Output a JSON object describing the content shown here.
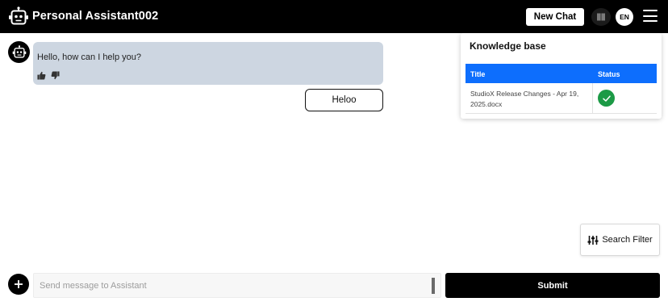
{
  "header": {
    "app_title": "Personal Assistant002",
    "new_chat_label": "New Chat",
    "language": "EN",
    "icons": [
      "robot-logo-icon",
      "book-icon",
      "hamburger-menu-icon"
    ]
  },
  "chat": {
    "messages": [
      {
        "role": "assistant",
        "text": "Hello, how can I help you?"
      },
      {
        "role": "user",
        "text": "Heloo"
      }
    ]
  },
  "knowledge_base": {
    "title": "Knowledge base",
    "columns": [
      "Title",
      "Status"
    ],
    "rows": [
      {
        "title": "StudioX Release Changes - Apr 19, 2025.docx",
        "status_icon": "check-icon"
      }
    ]
  },
  "search_filter": {
    "label": "Search Filter"
  },
  "composer": {
    "placeholder": "Send message to Assistant",
    "value": "",
    "submit_label": "Submit"
  },
  "colors": {
    "header_bg": "#000000",
    "assistant_bubble": "#cdd6e1",
    "table_header": "#0d6efd",
    "status_ok": "#1c9a46"
  }
}
